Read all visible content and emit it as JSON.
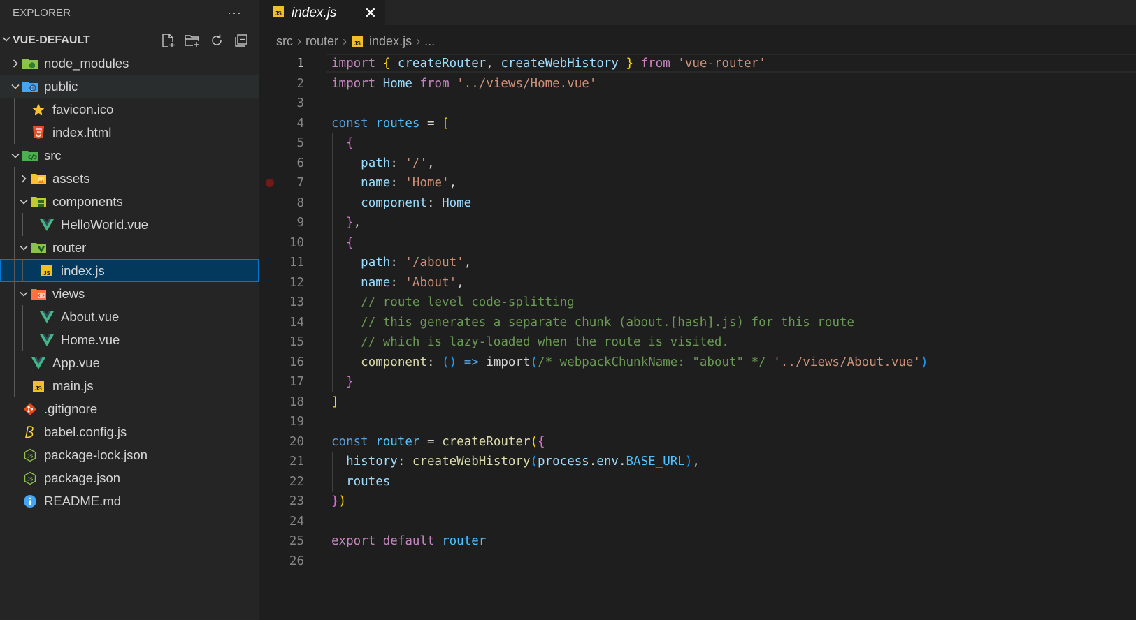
{
  "explorer": {
    "title": "EXPLORER",
    "more_label": "···",
    "project_name": "VUE-DEFAULT",
    "actions": [
      "new-file-icon",
      "new-folder-icon",
      "refresh-icon",
      "collapse-all-icon"
    ],
    "tree": [
      {
        "label": "node_modules",
        "icon": "folder-node-icon",
        "depth": 0,
        "chevron": "right"
      },
      {
        "label": "public",
        "icon": "folder-public-icon",
        "depth": 0,
        "chevron": "down",
        "state": "active-folder"
      },
      {
        "label": "favicon.ico",
        "icon": "star-icon",
        "depth": 1
      },
      {
        "label": "index.html",
        "icon": "html5-icon",
        "depth": 1
      },
      {
        "label": "src",
        "icon": "folder-src-icon",
        "depth": 0,
        "chevron": "down"
      },
      {
        "label": "assets",
        "icon": "folder-assets-icon",
        "depth": 1,
        "chevron": "right"
      },
      {
        "label": "components",
        "icon": "folder-components-icon",
        "depth": 1,
        "chevron": "down"
      },
      {
        "label": "HelloWorld.vue",
        "icon": "vue-icon",
        "depth": 2
      },
      {
        "label": "router",
        "icon": "folder-router-icon",
        "depth": 1,
        "chevron": "down"
      },
      {
        "label": "index.js",
        "icon": "js-icon",
        "depth": 2,
        "state": "selected"
      },
      {
        "label": "views",
        "icon": "folder-views-icon",
        "depth": 1,
        "chevron": "down"
      },
      {
        "label": "About.vue",
        "icon": "vue-icon",
        "depth": 2
      },
      {
        "label": "Home.vue",
        "icon": "vue-icon",
        "depth": 2
      },
      {
        "label": "App.vue",
        "icon": "vue-icon",
        "depth": 1
      },
      {
        "label": "main.js",
        "icon": "js-icon",
        "depth": 1
      },
      {
        "label": ".gitignore",
        "icon": "git-icon",
        "depth": 0
      },
      {
        "label": "babel.config.js",
        "icon": "babel-icon",
        "depth": 0
      },
      {
        "label": "package-lock.json",
        "icon": "nodejs-icon",
        "depth": 0
      },
      {
        "label": "package.json",
        "icon": "nodejs-icon",
        "depth": 0
      },
      {
        "label": "README.md",
        "icon": "info-icon",
        "depth": 0
      }
    ]
  },
  "tab": {
    "label": "index.js",
    "close": "✕"
  },
  "breadcrumb": {
    "items": [
      "src",
      "router",
      "index.js",
      "..."
    ],
    "sep": "›"
  },
  "editor": {
    "current_line": 1,
    "breakpoint_line": 7,
    "lines": [
      [
        [
          "kw",
          "import"
        ],
        [
          "txt",
          " "
        ],
        [
          "b1",
          "{"
        ],
        [
          "txt",
          " "
        ],
        [
          "var",
          "createRouter"
        ],
        [
          "txt",
          ", "
        ],
        [
          "var",
          "createWebHistory"
        ],
        [
          "txt",
          " "
        ],
        [
          "b1",
          "}"
        ],
        [
          "txt",
          " "
        ],
        [
          "kw",
          "from"
        ],
        [
          "txt",
          " "
        ],
        [
          "str",
          "'vue-router'"
        ]
      ],
      [
        [
          "kw",
          "import"
        ],
        [
          "txt",
          " "
        ],
        [
          "var",
          "Home"
        ],
        [
          "txt",
          " "
        ],
        [
          "kw",
          "from"
        ],
        [
          "txt",
          " "
        ],
        [
          "str",
          "'../views/Home.vue'"
        ]
      ],
      [],
      [
        [
          "kw2",
          "const"
        ],
        [
          "txt",
          " "
        ],
        [
          "cst",
          "routes"
        ],
        [
          "txt",
          " = "
        ],
        [
          "b1",
          "["
        ]
      ],
      [
        [
          "txt",
          "  "
        ],
        [
          "b2",
          "{"
        ]
      ],
      [
        [
          "txt",
          "    "
        ],
        [
          "var",
          "path"
        ],
        [
          "txt",
          ": "
        ],
        [
          "str",
          "'/'"
        ],
        [
          "txt",
          ","
        ]
      ],
      [
        [
          "txt",
          "    "
        ],
        [
          "var",
          "name"
        ],
        [
          "txt",
          ": "
        ],
        [
          "str",
          "'Home'"
        ],
        [
          "txt",
          ","
        ]
      ],
      [
        [
          "txt",
          "    "
        ],
        [
          "var",
          "component"
        ],
        [
          "txt",
          ": "
        ],
        [
          "var",
          "Home"
        ]
      ],
      [
        [
          "txt",
          "  "
        ],
        [
          "b2",
          "}"
        ],
        [
          "txt",
          ","
        ]
      ],
      [
        [
          "txt",
          "  "
        ],
        [
          "b2",
          "{"
        ]
      ],
      [
        [
          "txt",
          "    "
        ],
        [
          "var",
          "path"
        ],
        [
          "txt",
          ": "
        ],
        [
          "str",
          "'/about'"
        ],
        [
          "txt",
          ","
        ]
      ],
      [
        [
          "txt",
          "    "
        ],
        [
          "var",
          "name"
        ],
        [
          "txt",
          ": "
        ],
        [
          "str",
          "'About'"
        ],
        [
          "txt",
          ","
        ]
      ],
      [
        [
          "txt",
          "    "
        ],
        [
          "cm",
          "// route level code-splitting"
        ]
      ],
      [
        [
          "txt",
          "    "
        ],
        [
          "cm",
          "// this generates a separate chunk (about.[hash].js) for this route"
        ]
      ],
      [
        [
          "txt",
          "    "
        ],
        [
          "cm",
          "// which is lazy-loaded when the route is visited."
        ]
      ],
      [
        [
          "txt",
          "    "
        ],
        [
          "fn",
          "component"
        ],
        [
          "txt",
          ": "
        ],
        [
          "b3",
          "()"
        ],
        [
          "txt",
          " "
        ],
        [
          "kw2",
          "=>"
        ],
        [
          "txt",
          " "
        ],
        [
          "txt",
          "import"
        ],
        [
          "b3",
          "("
        ],
        [
          "cm",
          "/* webpackChunkName: \"about\" */"
        ],
        [
          "txt",
          " "
        ],
        [
          "str",
          "'../views/About.vue'"
        ],
        [
          "b3",
          ")"
        ]
      ],
      [
        [
          "txt",
          "  "
        ],
        [
          "b2",
          "}"
        ]
      ],
      [
        [
          "b1",
          "]"
        ]
      ],
      [],
      [
        [
          "kw2",
          "const"
        ],
        [
          "txt",
          " "
        ],
        [
          "cst",
          "router"
        ],
        [
          "txt",
          " = "
        ],
        [
          "fn",
          "createRouter"
        ],
        [
          "b1",
          "("
        ],
        [
          "b2",
          "{"
        ]
      ],
      [
        [
          "txt",
          "  "
        ],
        [
          "var",
          "history"
        ],
        [
          "txt",
          ": "
        ],
        [
          "fn",
          "createWebHistory"
        ],
        [
          "b3",
          "("
        ],
        [
          "var",
          "process"
        ],
        [
          "txt",
          "."
        ],
        [
          "var",
          "env"
        ],
        [
          "txt",
          "."
        ],
        [
          "cst",
          "BASE_URL"
        ],
        [
          "b3",
          ")"
        ],
        [
          "txt",
          ","
        ]
      ],
      [
        [
          "txt",
          "  "
        ],
        [
          "var",
          "routes"
        ]
      ],
      [
        [
          "b2",
          "}"
        ],
        [
          "b1",
          ")"
        ]
      ],
      [],
      [
        [
          "kw",
          "export"
        ],
        [
          "txt",
          " "
        ],
        [
          "kw",
          "default"
        ],
        [
          "txt",
          " "
        ],
        [
          "cst",
          "router"
        ]
      ],
      []
    ]
  }
}
